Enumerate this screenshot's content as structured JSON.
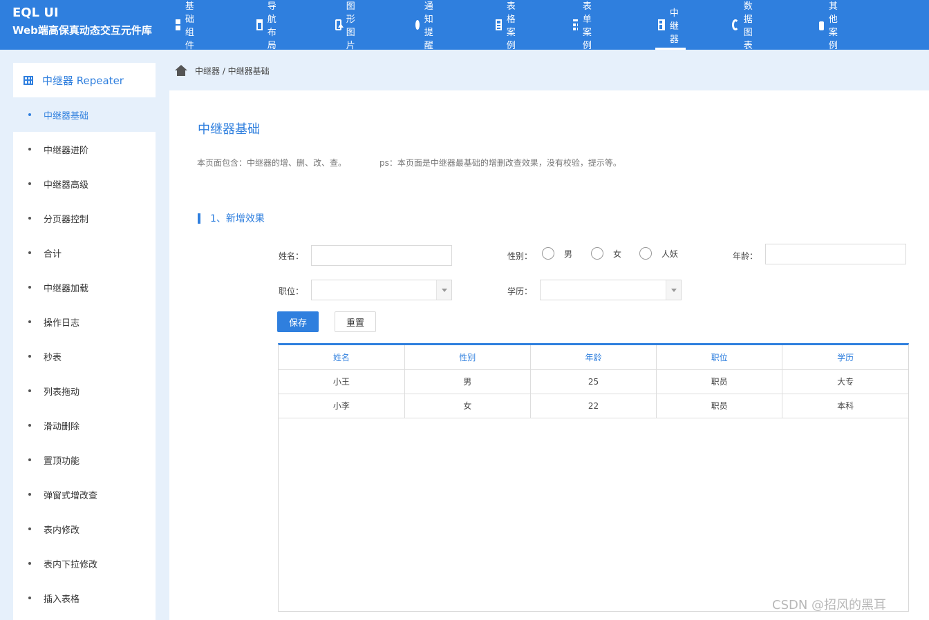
{
  "brand": {
    "title": "EQL UI",
    "subtitle": "Web端高保真动态交互元件库"
  },
  "nav": [
    {
      "label": "基础组件",
      "icon": "grid-icon"
    },
    {
      "label": "导航布局",
      "icon": "layout-icon"
    },
    {
      "label": "图形图片",
      "icon": "image-icon"
    },
    {
      "label": "通知提醒",
      "icon": "drop-icon"
    },
    {
      "label": "表格案例",
      "icon": "table-icon"
    },
    {
      "label": "表单案例",
      "icon": "form-icon"
    },
    {
      "label": "中继器",
      "icon": "repeater-icon",
      "active": true
    },
    {
      "label": "数据图表",
      "icon": "pie-chart-icon"
    },
    {
      "label": "其他案例",
      "icon": "wallet-icon"
    }
  ],
  "sidebar": {
    "header": "中继器 Repeater",
    "active_item": "中继器基础",
    "items": [
      "中继器进阶",
      "中继器高级",
      "分页器控制",
      "合计",
      "中继器加载",
      "操作日志",
      "秒表",
      "列表拖动",
      "滑动删除",
      "置顶功能",
      "弹窗式增改查",
      "表内修改",
      "表内下拉修改",
      "插入表格"
    ]
  },
  "breadcrumb": "中继器 / 中继器基础",
  "page": {
    "title": "中继器基础",
    "description": "本页面包含：中继器的增、删、改、查。",
    "note": "ps：本页面是中继器最基础的增删改查效果，没有校验，提示等。",
    "section_title": "1、新增效果"
  },
  "form": {
    "name_label": "姓名：",
    "name_value": "",
    "gender_label": "性别：",
    "gender_options": [
      "男",
      "女",
      "人妖"
    ],
    "age_label": "年龄：",
    "age_value": "",
    "position_label": "职位：",
    "position_value": "",
    "education_label": "学历：",
    "education_value": "",
    "save_label": "保存",
    "reset_label": "重置"
  },
  "table": {
    "headers": [
      "姓名",
      "性别",
      "年龄",
      "职位",
      "学历"
    ],
    "rows": [
      [
        "小王",
        "男",
        "25",
        "职员",
        "大专"
      ],
      [
        "小李",
        "女",
        "22",
        "职员",
        "本科"
      ]
    ]
  },
  "watermark": "CSDN @招风的黑耳",
  "colors": {
    "primary": "#2f7fde",
    "background": "#e6f0fb"
  }
}
